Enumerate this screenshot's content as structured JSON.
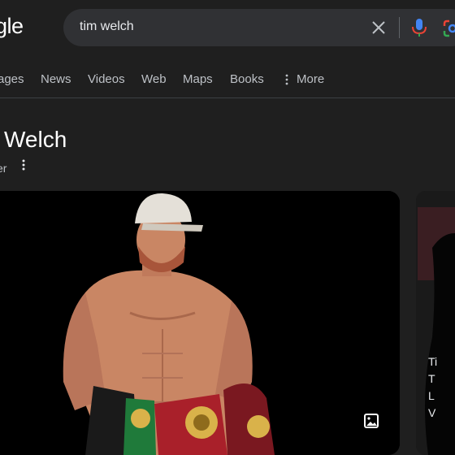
{
  "logo_text": "gle",
  "search": {
    "query": "tim welch"
  },
  "tabs": [
    "ages",
    "News",
    "Videos",
    "Web",
    "Maps",
    "Books",
    "More"
  ],
  "entity": {
    "title": "Welch",
    "subtitle": "er"
  },
  "side_card": {
    "lines": [
      "Ti",
      "T",
      "L",
      "V"
    ]
  },
  "icons": {
    "clear": "close-icon",
    "mic": "microphone-icon",
    "lens": "google-lens-icon",
    "more": "more-vert-icon",
    "image": "image-icon"
  },
  "colors": {
    "background": "#1f1f1f",
    "searchbar": "#303134",
    "tab_text": "#bdc1c6",
    "mic_blue": "#4285f4",
    "mic_red": "#ea4335"
  }
}
